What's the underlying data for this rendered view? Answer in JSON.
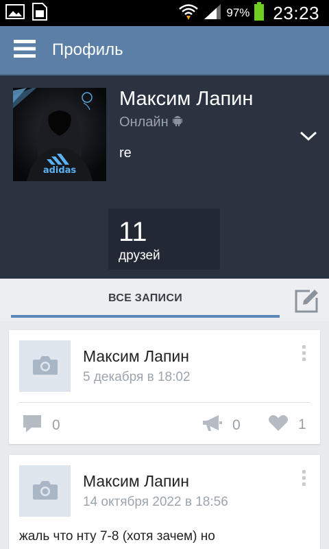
{
  "status_bar": {
    "battery_percent": "97%",
    "time": "23:23",
    "icons": [
      "gallery-notification-icon",
      "sim-card-icon",
      "wifi-icon",
      "signal-icon",
      "battery-icon"
    ]
  },
  "app_bar": {
    "title": "Профиль",
    "menu_icon": "hamburger-menu-icon"
  },
  "profile": {
    "name": "Максим Лапин",
    "online_status": "Онлайн",
    "status_text": "re",
    "avatar_logo_text": "adidas",
    "friends_count": "11",
    "friends_label": "друзей"
  },
  "tabs": {
    "all_posts_label": "ВСЕ ЗАПИСИ",
    "compose_icon": "compose-icon"
  },
  "posts": [
    {
      "author": "Максим Лапин",
      "date": "5 декабря в 18:02",
      "comments": "0",
      "shares": "0",
      "likes": "1"
    },
    {
      "author": "Максим Лапин",
      "date": "14 октября 2022 в 18:56",
      "text": "жаль что нту 7-8 (хотя зачем) но"
    }
  ],
  "colors": {
    "app_bar": "#5b7fa6",
    "profile_bg": "#2c3340",
    "accent": "#5b88b8"
  }
}
